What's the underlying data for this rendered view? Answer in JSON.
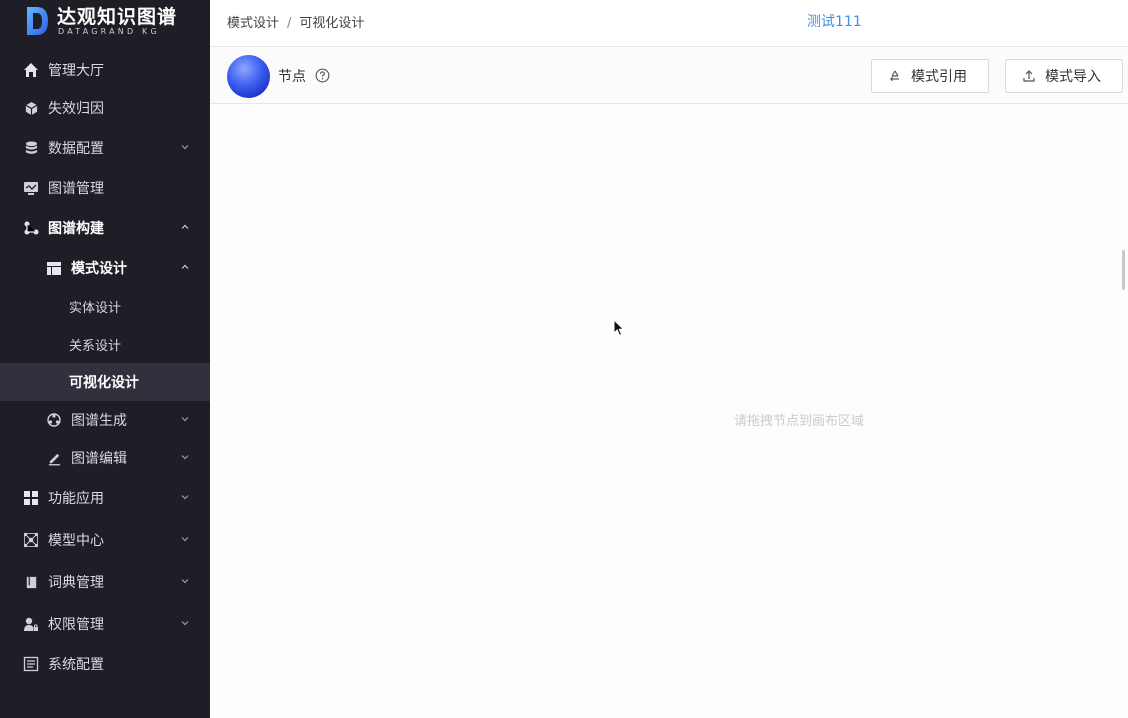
{
  "app": {
    "logo_text": "达观知识图谱",
    "logo_sub": "DATAGRAND KG"
  },
  "sidebar": {
    "items": [
      {
        "label": "管理大厅",
        "icon": "home-icon"
      },
      {
        "label": "失效归因",
        "icon": "cube-icon"
      },
      {
        "label": "数据配置",
        "icon": "database-icon",
        "expandable": true
      },
      {
        "label": "图谱管理",
        "icon": "monitor-icon"
      },
      {
        "label": "图谱构建",
        "icon": "graph-build-icon",
        "expanded": true
      },
      {
        "label": "模式设计",
        "icon": "layout-icon",
        "expanded": true
      },
      {
        "label": "实体设计"
      },
      {
        "label": "关系设计"
      },
      {
        "label": "可视化设计",
        "active": true
      },
      {
        "label": "图谱生成",
        "icon": "generate-icon",
        "expandable": true
      },
      {
        "label": "图谱编辑",
        "icon": "edit-icon",
        "expandable": true
      },
      {
        "label": "功能应用",
        "icon": "grid-icon",
        "expandable": true
      },
      {
        "label": "模型中心",
        "icon": "network-icon",
        "expandable": true
      },
      {
        "label": "词典管理",
        "icon": "book-icon",
        "expandable": true
      },
      {
        "label": "权限管理",
        "icon": "user-lock-icon",
        "expandable": true
      },
      {
        "label": "系统配置",
        "icon": "settings-doc-icon"
      }
    ]
  },
  "header": {
    "breadcrumb": [
      "模式设计",
      "可视化设计"
    ],
    "breadcrumb_sep": "/",
    "project": "测试111"
  },
  "toolbar": {
    "node_label": "节点",
    "ref_button": "模式引用",
    "import_button": "模式导入"
  },
  "canvas": {
    "hint": "请拖拽节点到画布区域"
  },
  "colors": {
    "sidebar_bg": "#1f1e27",
    "active_bg": "#31313d",
    "accent": "#3d8ee6"
  }
}
